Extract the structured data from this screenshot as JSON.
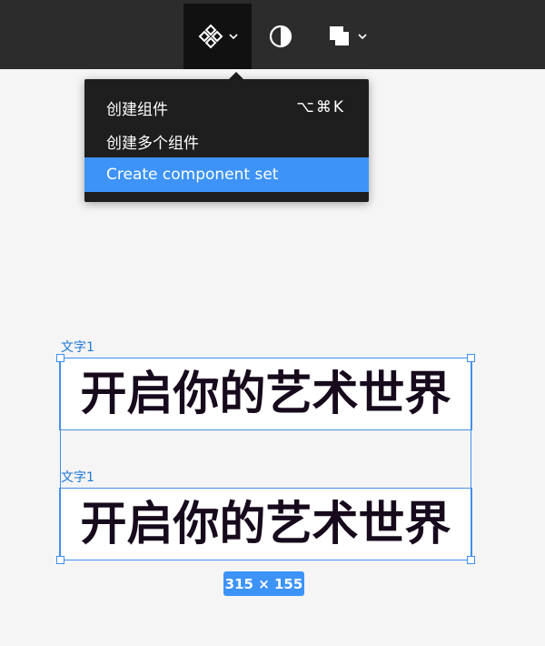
{
  "toolbar": {
    "component_tool_icon": "component-icon",
    "mask_tool_icon": "mask-icon",
    "boolean_tool_icon": "boolean-union-icon"
  },
  "menu": {
    "items": [
      {
        "label": "创建组件",
        "shortcut": "⌥⌘K",
        "highlighted": false
      },
      {
        "label": "创建多个组件",
        "shortcut": "",
        "highlighted": false
      },
      {
        "label": "Create component set",
        "shortcut": "",
        "highlighted": true
      }
    ]
  },
  "canvas": {
    "frames": [
      {
        "name": "文字1",
        "text": "开启你的艺术世界"
      },
      {
        "name": "文字1",
        "text": "开启你的艺术世界"
      }
    ],
    "selection_size": "315 × 155"
  },
  "colors": {
    "toolbar_bg": "#2c2c2c",
    "menu_bg": "#1e1e1e",
    "highlight": "#3d93f8",
    "selection": "#3d8ff0",
    "frame_label": "#1d78d6"
  }
}
